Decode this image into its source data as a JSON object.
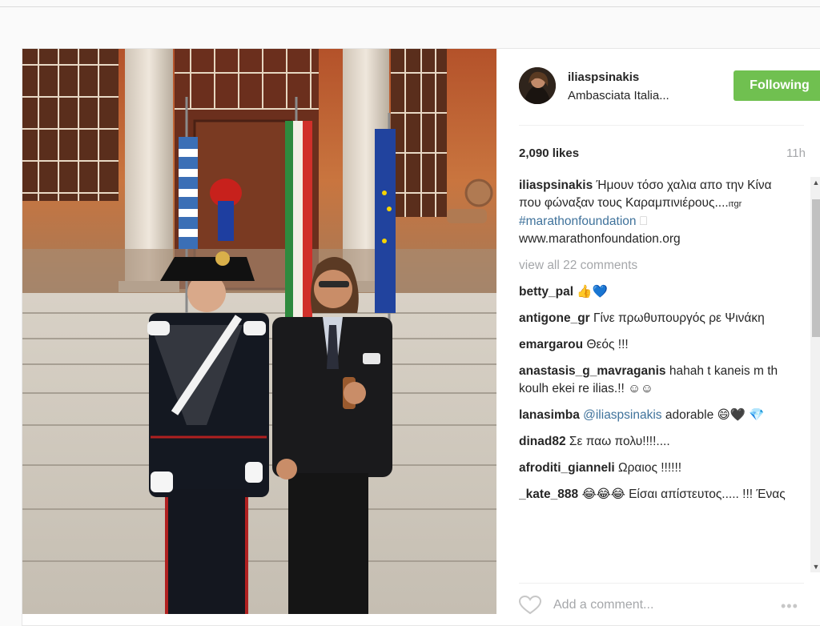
{
  "post": {
    "username": "iliaspsinakis",
    "location": "Ambasciata Italia...",
    "follow_label": "Following",
    "likes": "2,090 likes",
    "time": "11h",
    "caption": {
      "user": "iliaspsinakis",
      "text": "Ήμουν τόσο χαλια απο την Κίνα που φώναξαν τους Καραμπινιέρους....",
      "tag_suffix": "ιτgr",
      "hashtag": "#marathonfoundation",
      "hashtag_suffix": " ⎕",
      "link": "www.marathonfoundation.org"
    },
    "view_all": "view all 22 comments",
    "comments": [
      {
        "user": "betty_pal",
        "text": "👍💙"
      },
      {
        "user": "antigone_gr",
        "text": "Γίνε πρωθυπουργός ρε Ψινάκη"
      },
      {
        "user": "emargarou",
        "text": "Θεός !!!"
      },
      {
        "user": "anastasis_g_mavraganis",
        "text": "hahah t kaneis m th koulh ekei re ilias.!! ☺☺"
      },
      {
        "user": "lanasimba",
        "mention": "@iliaspsinakis",
        "text": "adorable 😄🖤 💎"
      },
      {
        "user": "dinad82",
        "text": "Σε παω πολυ!!!!...."
      },
      {
        "user": "afroditi_gianneli",
        "text": "Ωραιος !!!!!!"
      },
      {
        "user": "_kate_888",
        "text": "😂😂😂 Είσαι απίστευτος..... !!! Ένας"
      }
    ],
    "add_comment_placeholder": "Add a comment...",
    "more_label": "•••"
  },
  "icons": {
    "like": "heart-outline-icon",
    "more": "more-options-icon",
    "scroll_up": "scroll-up-arrow-icon",
    "scroll_down": "scroll-down-arrow-icon"
  },
  "colors": {
    "follow_button": "#70c050",
    "hashtag": "#3f729b",
    "muted": "#a5a7aa"
  }
}
